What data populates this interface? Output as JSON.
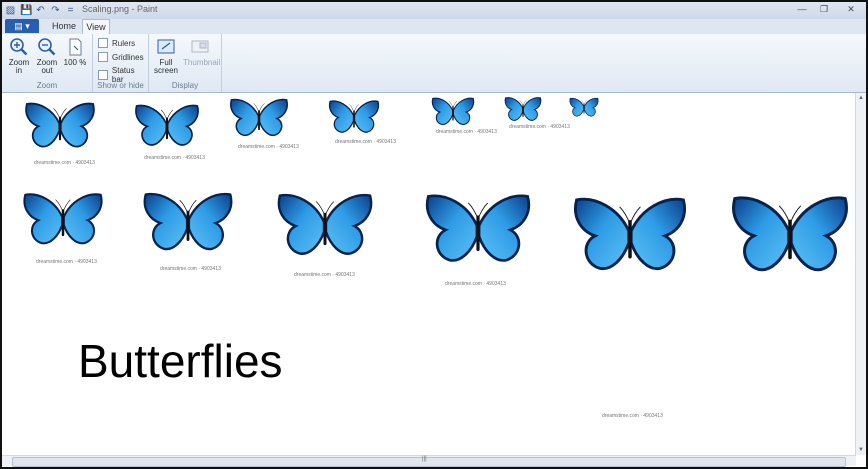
{
  "window": {
    "title": "Scaling.png - Paint",
    "controls": [
      "—",
      "❐",
      "✕"
    ]
  },
  "quick_access": [
    "💾",
    "↶",
    "↷",
    "="
  ],
  "tabs": {
    "file": "▤ ▾",
    "home": "Home",
    "view": "View"
  },
  "ribbon": {
    "zoom": {
      "label": "Zoom",
      "zoom_in": "Zoom in",
      "zoom_out": "Zoom out",
      "hundred": "100 %"
    },
    "show_hide": {
      "label": "Show or hide",
      "rulers": "Rulers",
      "gridlines": "Gridlines",
      "status_bar": "Status bar"
    },
    "display": {
      "label": "Display",
      "full_screen": "Full screen",
      "thumbnail": "Thumbnail"
    }
  },
  "canvas": {
    "text": "Butterflies",
    "caption": "dreamstime.com · 4903413"
  },
  "colors": {
    "butterfly_dark": "#0b3f8a",
    "butterfly_light": "#2e9be6",
    "ribbon_accent": "#2a5cb0"
  }
}
